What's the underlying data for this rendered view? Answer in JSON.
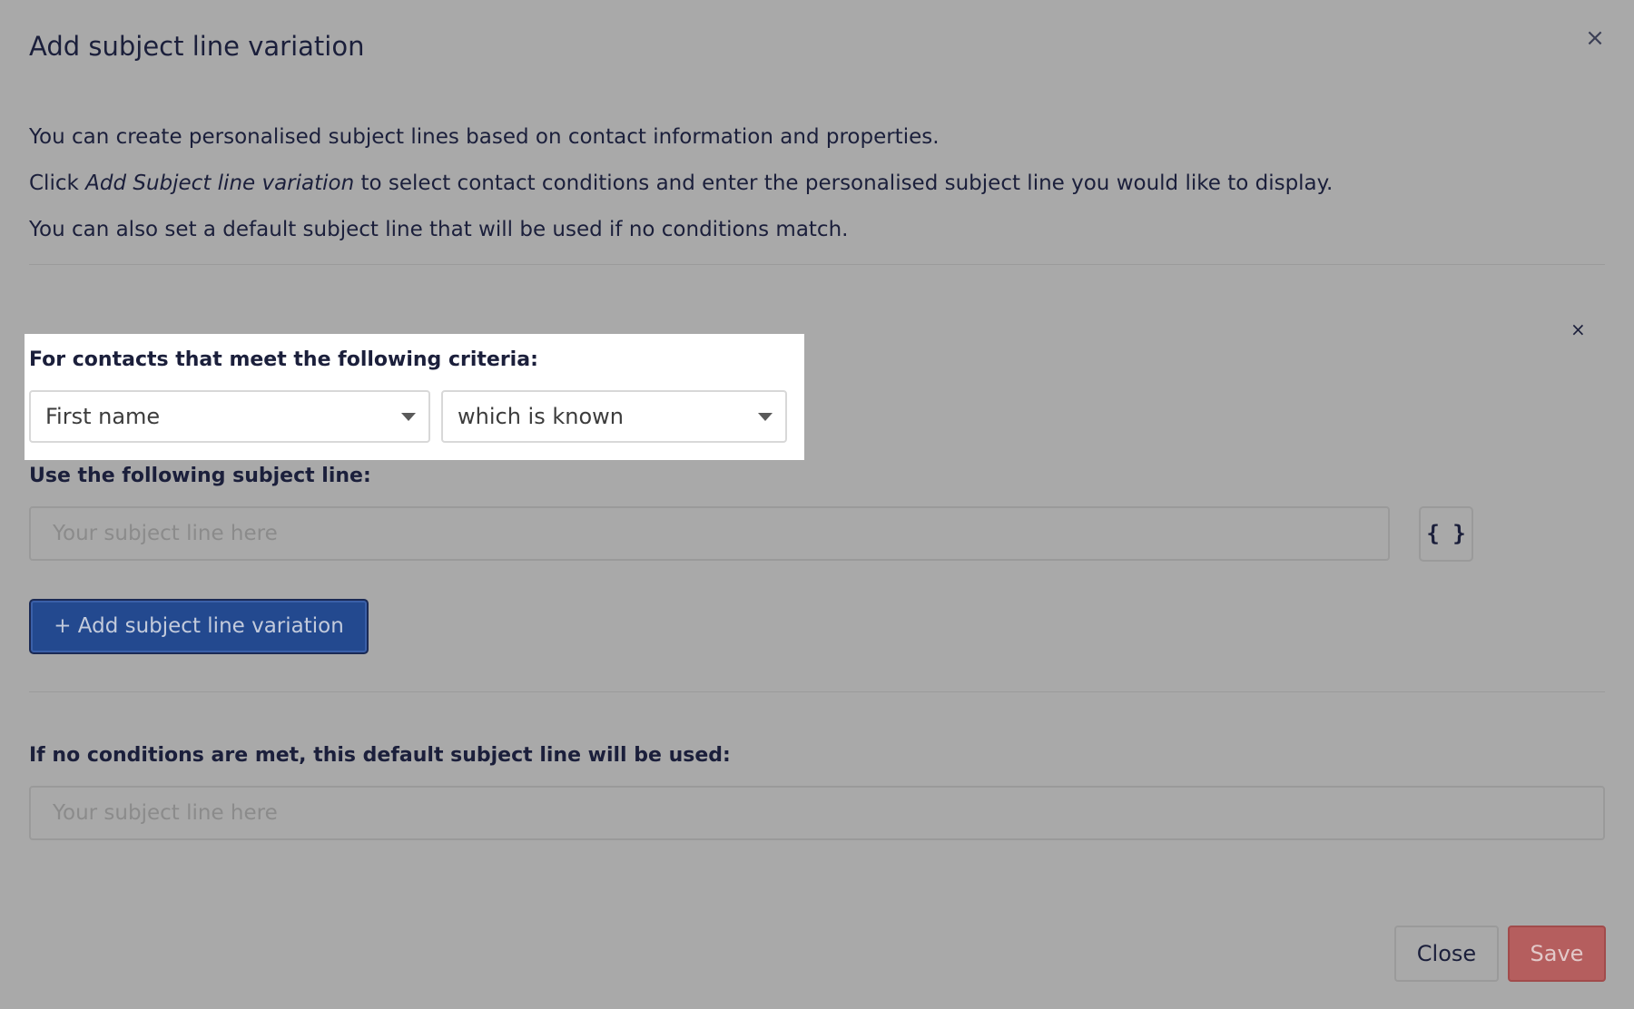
{
  "modal": {
    "title": "Add subject line variation",
    "close_icon": "close-icon"
  },
  "intro": {
    "line1": "You can create personalised subject lines based on contact information and properties.",
    "line2_prefix": "Click ",
    "line2_emphasis": "Add Subject line variation",
    "line2_suffix": " to select contact conditions and enter the personalised subject line you would like to display.",
    "line3": "You can also set a default subject line that will be used if no conditions match."
  },
  "variation": {
    "criteria_label": "For contacts that meet the following criteria:",
    "field_select": {
      "selected": "First name"
    },
    "condition_select": {
      "selected": "which is known"
    },
    "remove_icon": "remove-icon",
    "subject_label": "Use the following subject line:",
    "subject_input": {
      "value": "",
      "placeholder": "Your subject line here"
    },
    "personalisation_button": "{ }"
  },
  "add_button": {
    "label": "+ Add subject line variation"
  },
  "default_section": {
    "label": "If no conditions are met, this default subject line will be used:",
    "input": {
      "value": "",
      "placeholder": "Your subject line here"
    }
  },
  "footer": {
    "close_label": "Close",
    "save_label": "Save"
  },
  "colors": {
    "overlay": "#a9a9a9",
    "primary": "#23498f",
    "danger": "#b55e5e",
    "text": "#1b1f3b"
  }
}
